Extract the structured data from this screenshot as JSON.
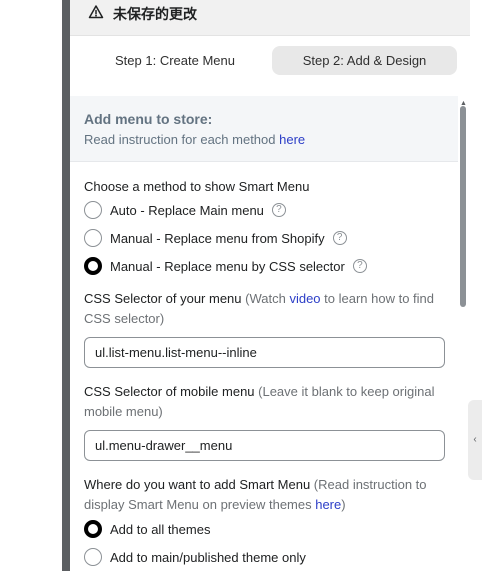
{
  "unsaved_bar": {
    "icon": "warning-triangle-icon",
    "label": "未保存的更改"
  },
  "steps": [
    {
      "label": "Step 1: Create Menu",
      "active": false
    },
    {
      "label": "Step 2: Add & Design",
      "active": true
    }
  ],
  "store_box": {
    "title": "Add menu to store:",
    "instruction": "Read instruction for each method ",
    "link": "here"
  },
  "method": {
    "heading": "Choose a method to show Smart Menu",
    "options": [
      {
        "label": "Auto - Replace Main menu",
        "checked": false
      },
      {
        "label": "Manual - Replace menu from Shopify",
        "checked": false
      },
      {
        "label": "Manual - Replace menu by CSS selector",
        "checked": true
      }
    ],
    "help_glyph": "?"
  },
  "css_selector": {
    "label": "CSS Selector of your menu",
    "hint_before": " (Watch ",
    "hint_link": "video",
    "hint_after": " to learn how to find CSS selector)",
    "value": "ul.list-menu.list-menu--inline"
  },
  "mobile_selector": {
    "label": "CSS Selector of mobile menu",
    "hint": " (Leave it blank to keep original mobile menu)",
    "value": "ul.menu-drawer__menu"
  },
  "placement": {
    "label": "Where do you want to add Smart Menu",
    "hint_before": " (Read instruction to display Smart Menu on preview themes ",
    "hint_link": "here",
    "hint_after": ")",
    "options": [
      {
        "label": "Add to all themes",
        "checked": true
      },
      {
        "label": "Add to main/published theme only",
        "checked": false
      }
    ]
  },
  "scrollbar": {
    "up_glyph": "▲"
  },
  "collapse_tab": {
    "glyph": "‹"
  },
  "colors": {
    "link": "#2c3ec7",
    "muted": "#637381",
    "active_step_bg": "#e8e8e8",
    "dark_strip": "#5c5f62"
  }
}
